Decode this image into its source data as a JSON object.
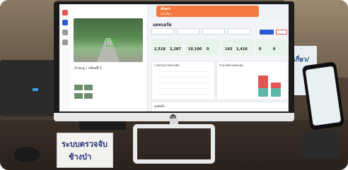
{
  "photo": {
    "desk_sign_line1": "ระบบตรวจจับ",
    "desk_sign_line2": "ช้างป่า",
    "right_box_text": "เกี่ยว/",
    "monitor_brand": "hp"
  },
  "dashboard": {
    "alert_title": "Alert",
    "alert_sub": "แจ้งเตือน",
    "page_title": "แดชบอร์ด",
    "camera_title": "ป่าละอู / กล้องที่ 1",
    "stats": [
      "2,518",
      "2,287",
      "10,100",
      "0",
      "142",
      "1,416",
      "0",
      "6"
    ],
    "chart_title": "ภาพรวมการตรวจจับ",
    "bar_chart_title": "จำนวนช้างแต่ละจุด",
    "section_title": "จุดติดตั้ง"
  },
  "colors": {
    "alert": "#f27a40",
    "accent_blue": "#2a5bd7",
    "stat_green": "#e6f4ea",
    "bar_red": "#e25555",
    "bar_teal": "#5ab8a6"
  }
}
